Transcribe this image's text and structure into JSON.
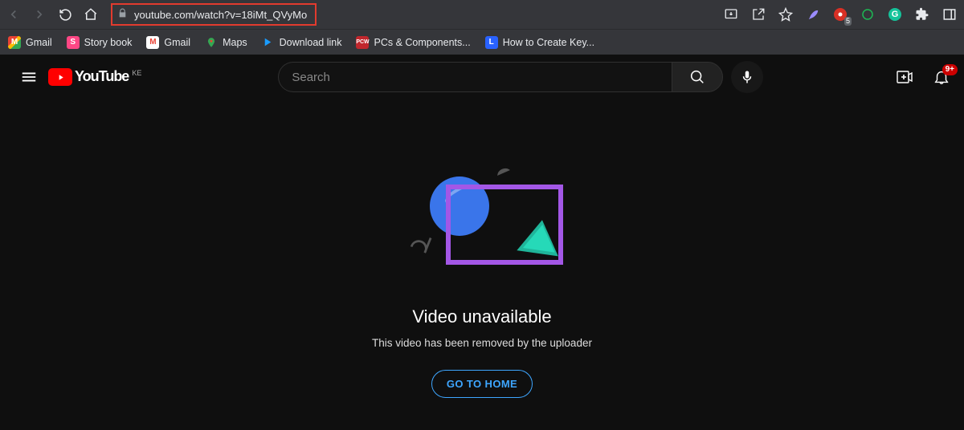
{
  "browser": {
    "url": "youtube.com/watch?v=18iMt_QVyMo",
    "extensions_count": "5"
  },
  "bookmarks": [
    {
      "label": "Gmail"
    },
    {
      "label": "Story book"
    },
    {
      "label": "Gmail"
    },
    {
      "label": "Maps"
    },
    {
      "label": "Download link"
    },
    {
      "label": "PCs & Components..."
    },
    {
      "label": "How to Create Key..."
    }
  ],
  "youtube": {
    "brand": "YouTube",
    "country": "KE",
    "search_placeholder": "Search",
    "notifications_badge": "9+"
  },
  "error": {
    "title": "Video unavailable",
    "subtitle": "This video has been removed by the uploader",
    "home_button": "GO TO HOME"
  }
}
